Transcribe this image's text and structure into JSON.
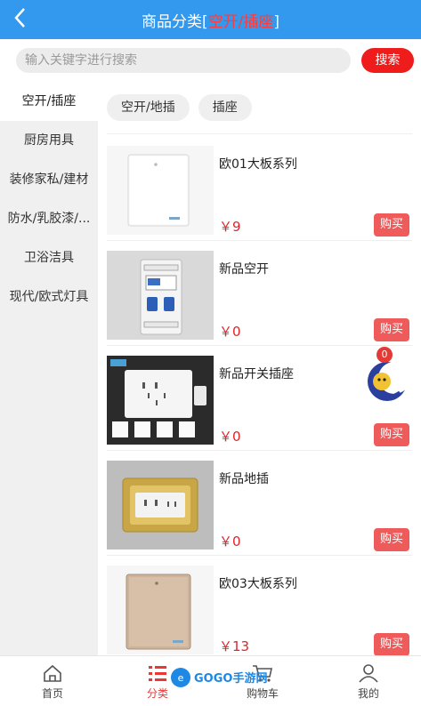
{
  "header": {
    "back_icon": "chevron-left-icon",
    "title_prefix": "商品分类[",
    "title_highlight": "空开/插座",
    "title_suffix": "]"
  },
  "search": {
    "placeholder": "输入关键字进行搜索",
    "button": "搜索"
  },
  "sidebar": {
    "items": [
      {
        "label": "空开/插座"
      },
      {
        "label": "厨房用具"
      },
      {
        "label": "装修家私/建材"
      },
      {
        "label": "防水/乳胶漆/..."
      },
      {
        "label": "卫浴洁具"
      },
      {
        "label": "现代/欧式灯具"
      }
    ]
  },
  "subtabs": [
    {
      "label": "空开/地插"
    },
    {
      "label": "插座"
    }
  ],
  "products": [
    {
      "name": "欧01大板系列",
      "price": "￥9",
      "buy": "购买"
    },
    {
      "name": "新品空开",
      "price": "￥0",
      "buy": "购买"
    },
    {
      "name": "新品开关插座",
      "price": "￥0",
      "buy": "购买"
    },
    {
      "name": "新品地插",
      "price": "￥0",
      "buy": "购买"
    },
    {
      "name": "欧03大板系列",
      "price": "￥13",
      "buy": "购买"
    }
  ],
  "floating_badge": {
    "count": "0",
    "icon": "cartoon-moon-mascot-icon"
  },
  "bottom_nav": [
    {
      "label": "首页",
      "icon": "home-icon"
    },
    {
      "label": "分类",
      "icon": "category-list-icon"
    },
    {
      "label": "购物车",
      "icon": "cart-icon"
    },
    {
      "label": "我的",
      "icon": "user-icon"
    }
  ],
  "watermark": {
    "text": "GOGO手游网"
  },
  "colors": {
    "header": "#3399ee",
    "accent_red": "#ef1c1c",
    "price_red": "#e0242a"
  }
}
